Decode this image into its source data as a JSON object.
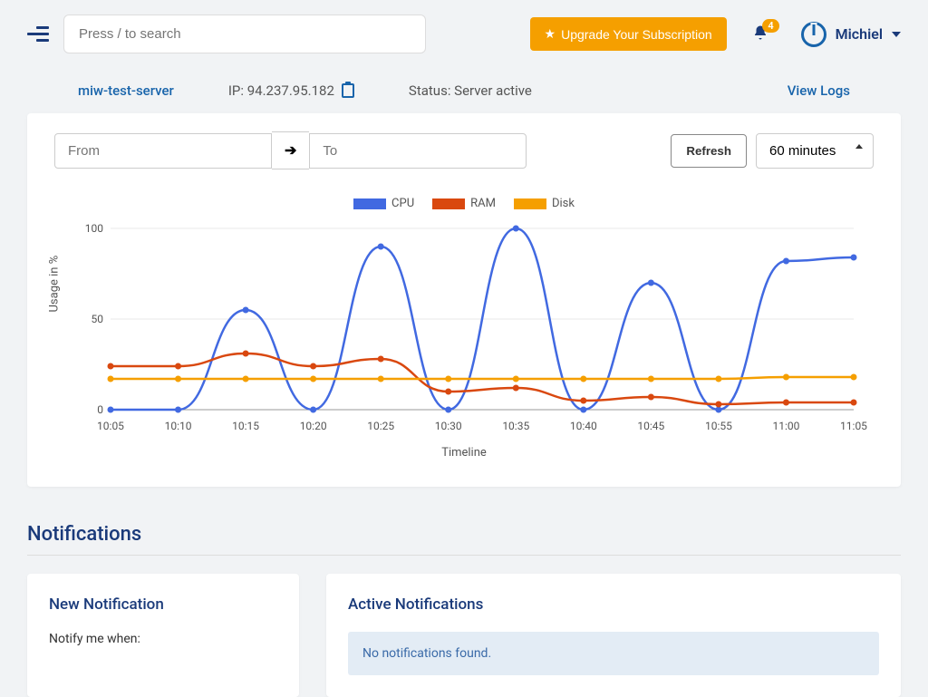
{
  "header": {
    "search_placeholder": "Press / to search",
    "upgrade_label": "Upgrade Your Subscription",
    "notification_count": "4",
    "user_name": "Michiel"
  },
  "server": {
    "name": "miw-test-server",
    "ip_label": "IP: 94.237.95.182",
    "status": "Status: Server active",
    "view_logs": "View Logs"
  },
  "controls": {
    "from_placeholder": "From",
    "to_placeholder": "To",
    "refresh": "Refresh",
    "interval": "60 minutes"
  },
  "chart_data": {
    "type": "line",
    "title": "",
    "xlabel": "Timeline",
    "ylabel": "Usage in %",
    "ylim": [
      0,
      100
    ],
    "categories": [
      "10:05",
      "10:10",
      "10:15",
      "10:20",
      "10:25",
      "10:30",
      "10:35",
      "10:40",
      "10:45",
      "10:55",
      "11:00",
      "11:05"
    ],
    "series": [
      {
        "name": "CPU",
        "color": "#4169e1",
        "values": [
          0,
          0,
          55,
          0,
          90,
          0,
          100,
          0,
          70,
          0,
          82,
          84
        ]
      },
      {
        "name": "RAM",
        "color": "#d9480f",
        "values": [
          24,
          24,
          31,
          24,
          28,
          10,
          12,
          5,
          7,
          3,
          4,
          4
        ]
      },
      {
        "name": "Disk",
        "color": "#f59f00",
        "values": [
          17,
          17,
          17,
          17,
          17,
          17,
          17,
          17,
          17,
          17,
          18,
          18
        ]
      }
    ],
    "y_ticks": [
      0,
      50,
      100
    ]
  },
  "notifications": {
    "section_title": "Notifications",
    "new_title": "New Notification",
    "prompt": "Notify me when:",
    "active_title": "Active Notifications",
    "empty": "No notifications found."
  }
}
